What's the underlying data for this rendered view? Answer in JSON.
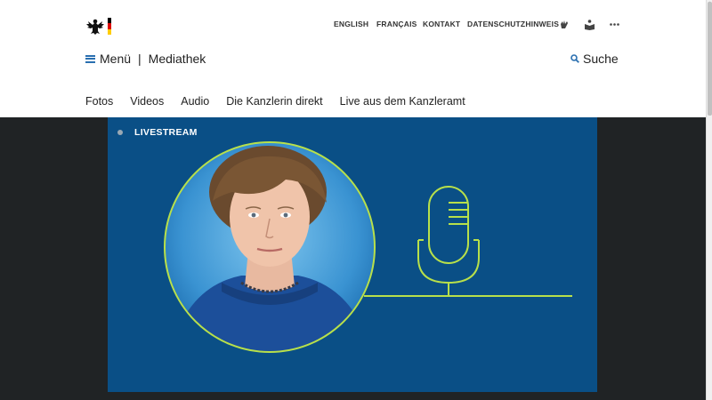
{
  "meta_nav": {
    "english": "ENGLISH",
    "francais": "FRANÇAIS",
    "kontakt": "KONTAKT",
    "datenschutz": "DATENSCHUTZHINWEIS",
    "icons": [
      "sign-language-icon",
      "easy-read-icon",
      "more-icon"
    ]
  },
  "header": {
    "menu_label": "Menü",
    "separator": "|",
    "section_title": "Mediathek",
    "search_label": "Suche"
  },
  "subnav": {
    "items": [
      "Fotos",
      "Videos",
      "Audio",
      "Die Kanzlerin direkt",
      "Live aus dem Kanzleramt"
    ]
  },
  "player": {
    "live_label": "LIVESTREAM",
    "colors": {
      "background": "#0a4f86",
      "accent_line": "#b8e04a",
      "portrait_bg": "#4aa8e0"
    }
  },
  "colors": {
    "flag_black": "#000000",
    "flag_red": "#dd0000",
    "flag_gold": "#ffcc00",
    "link_blue": "#2a6fb0",
    "stage_bg": "#202325"
  }
}
